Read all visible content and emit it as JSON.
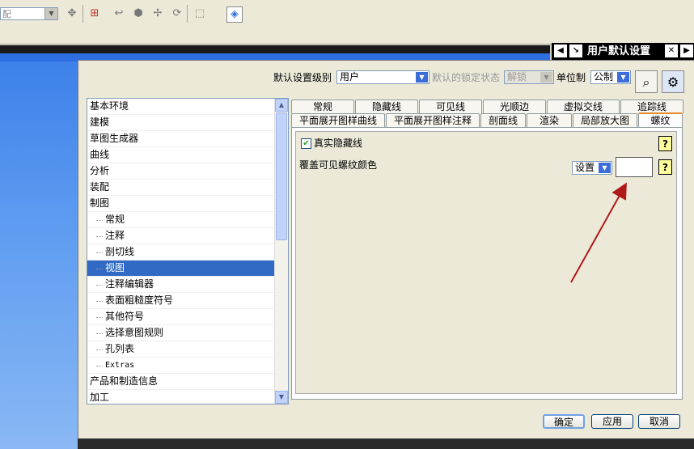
{
  "toolbar": {
    "combo_value": "配",
    "icons": [
      "transform-icon",
      "snap-point-icon",
      "undo-icon",
      "solid-icon",
      "move-icon",
      "rotate-icon",
      "select-box-icon",
      "view-cube-icon"
    ]
  },
  "dialog": {
    "title": "用户默认设置",
    "level_label": "默认设置级别",
    "level_value": "用户",
    "lock_label": "默认的锁定状态",
    "lock_value": "解锁",
    "unit_label": "单位制",
    "unit_value": "公制",
    "find_icon": "binoculars-icon",
    "manage_icon": "manage-defaults-icon"
  },
  "tree": {
    "items": [
      {
        "label": "基本环境",
        "level": 0
      },
      {
        "label": "建模",
        "level": 0
      },
      {
        "label": "草图生成器",
        "level": 0
      },
      {
        "label": "曲线",
        "level": 0
      },
      {
        "label": "分析",
        "level": 0
      },
      {
        "label": "装配",
        "level": 0
      },
      {
        "label": "制图",
        "level": 0
      },
      {
        "label": "常规",
        "level": 1
      },
      {
        "label": "注释",
        "level": 1
      },
      {
        "label": "剖切线",
        "level": 1
      },
      {
        "label": "视图",
        "level": 1,
        "selected": true
      },
      {
        "label": "注释编辑器",
        "level": 1
      },
      {
        "label": "表面粗糙度符号",
        "level": 1
      },
      {
        "label": "其他符号",
        "level": 1
      },
      {
        "label": "选择意图规则",
        "level": 1
      },
      {
        "label": "孔列表",
        "level": 1
      },
      {
        "label": "Extras",
        "level": 1
      },
      {
        "label": "产品和制造信息",
        "level": 0
      },
      {
        "label": "加工",
        "level": 0
      }
    ]
  },
  "tabs": {
    "row1": [
      "常规",
      "隐藏线",
      "可见线",
      "光顺边",
      "虚拟交线",
      "追踪线"
    ],
    "row2": [
      "平面展开图样曲线",
      "平面展开图样注释",
      "剖面线",
      "渲染",
      "局部放大图",
      "螺纹"
    ],
    "active": "螺纹"
  },
  "panel": {
    "true_hidden_label": "真实隐藏线",
    "true_hidden_checked": true,
    "override_color_label": "覆盖可见螺纹颜色",
    "setting_value": "设置",
    "help_glyph": "?",
    "swatch_color": "#ffffff",
    "arrow_color": "#b01a1a"
  },
  "buttons": {
    "ok": "确定",
    "apply": "应用",
    "cancel": "取消"
  }
}
